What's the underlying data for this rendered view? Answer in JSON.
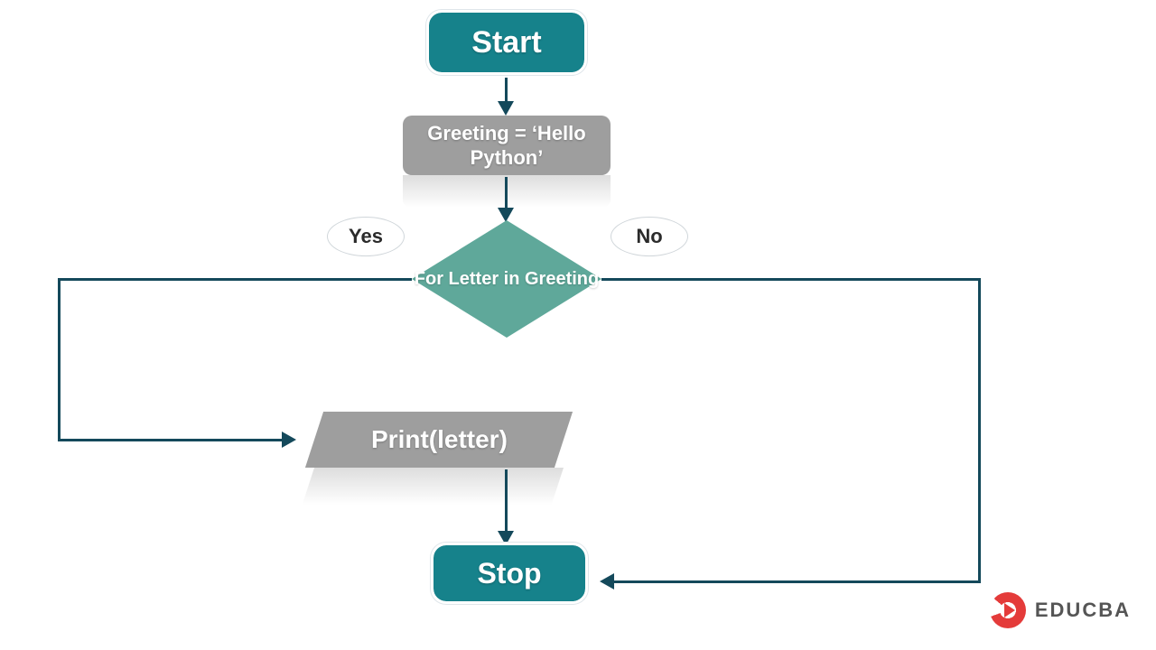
{
  "flowchart": {
    "start": {
      "label": "Start"
    },
    "process_init": {
      "label": "Greeting = ‘Hello Python’"
    },
    "decision": {
      "label": "For Letter in Greeting"
    },
    "branch_yes": {
      "label": "Yes"
    },
    "branch_no": {
      "label": "No"
    },
    "io_print": {
      "label": "Print(letter)"
    },
    "stop": {
      "label": "Stop"
    }
  },
  "brand": {
    "name": "EDUCBA"
  },
  "colors": {
    "terminal": "#16828b",
    "process": "#9e9e9e",
    "decision": "#5fa89a",
    "connector": "#14495b",
    "brand": "#e43b3a"
  }
}
